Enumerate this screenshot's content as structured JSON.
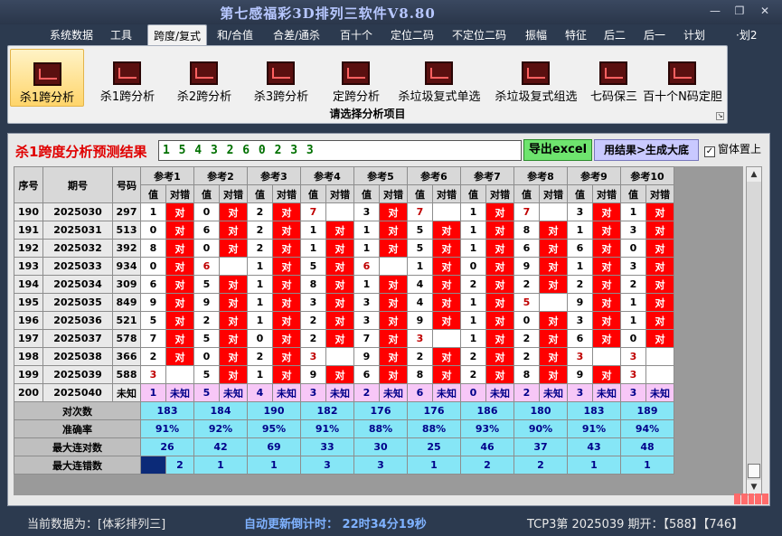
{
  "window": {
    "title": "第七感福彩3D排列三软件V8.80",
    "buttons": {
      "minimize": "—",
      "restore": "❐",
      "close": "✕"
    }
  },
  "menu": [
    "系统数据",
    "工具",
    "跨度/复式",
    "和/合值",
    "合差/通杀",
    "百十个",
    "定位二码",
    "不定位二码",
    "振幅",
    "特征",
    "后二",
    "后一",
    "计划",
    "·划2"
  ],
  "menu_active": 2,
  "ribbon": {
    "buttons": [
      "杀1跨分析",
      "杀1跨分析",
      "杀2跨分析",
      "杀3跨分析",
      "定跨分析",
      "杀垃圾复式单选",
      "杀垃圾复式组选",
      "七码保三",
      "百十个N码定胆"
    ],
    "selected": 0,
    "caption": "请选择分析项目",
    "icon": "chart-icon"
  },
  "result": {
    "title": "杀1跨度分析预测结果",
    "value": "1 5 4 3 2 6 0 2 3 3",
    "export_label": "导出excel",
    "generate_label": "用结果>生成大底",
    "pin_label": "窗体置上",
    "pin_checked": "✓"
  },
  "table": {
    "headers": {
      "seq": "序号",
      "period": "期号",
      "code": "号码"
    },
    "refs": [
      "参考1",
      "参考2",
      "参考3",
      "参考4",
      "参考5",
      "参考6",
      "参考7",
      "参考8",
      "参考9",
      "参考10"
    ],
    "sub": {
      "val": "值",
      "check": "对错"
    },
    "rows": [
      {
        "seq": "190",
        "period": "2025030",
        "code": "297",
        "refs": [
          [
            "1",
            "对"
          ],
          [
            "0",
            "对"
          ],
          [
            "2",
            "对"
          ],
          [
            "7",
            ""
          ],
          [
            "3",
            "对"
          ],
          [
            "7",
            ""
          ],
          [
            "1",
            "对"
          ],
          [
            "7",
            ""
          ],
          [
            "3",
            "对"
          ],
          [
            "1",
            "对"
          ]
        ]
      },
      {
        "seq": "191",
        "period": "2025031",
        "code": "513",
        "refs": [
          [
            "0",
            "对"
          ],
          [
            "6",
            "对"
          ],
          [
            "2",
            "对"
          ],
          [
            "1",
            "对"
          ],
          [
            "1",
            "对"
          ],
          [
            "5",
            "对"
          ],
          [
            "1",
            "对"
          ],
          [
            "8",
            "对"
          ],
          [
            "1",
            "对"
          ],
          [
            "3",
            "对"
          ]
        ]
      },
      {
        "seq": "192",
        "period": "2025032",
        "code": "392",
        "refs": [
          [
            "8",
            "对"
          ],
          [
            "0",
            "对"
          ],
          [
            "2",
            "对"
          ],
          [
            "1",
            "对"
          ],
          [
            "1",
            "对"
          ],
          [
            "5",
            "对"
          ],
          [
            "1",
            "对"
          ],
          [
            "6",
            "对"
          ],
          [
            "6",
            "对"
          ],
          [
            "0",
            "对"
          ]
        ]
      },
      {
        "seq": "193",
        "period": "2025033",
        "code": "934",
        "refs": [
          [
            "0",
            "对"
          ],
          [
            "6",
            ""
          ],
          [
            "1",
            "对"
          ],
          [
            "5",
            "对"
          ],
          [
            "6",
            ""
          ],
          [
            "1",
            "对"
          ],
          [
            "0",
            "对"
          ],
          [
            "9",
            "对"
          ],
          [
            "1",
            "对"
          ],
          [
            "3",
            "对"
          ]
        ]
      },
      {
        "seq": "194",
        "period": "2025034",
        "code": "309",
        "refs": [
          [
            "6",
            "对"
          ],
          [
            "5",
            "对"
          ],
          [
            "1",
            "对"
          ],
          [
            "8",
            "对"
          ],
          [
            "1",
            "对"
          ],
          [
            "4",
            "对"
          ],
          [
            "2",
            "对"
          ],
          [
            "2",
            "对"
          ],
          [
            "2",
            "对"
          ],
          [
            "2",
            "对"
          ]
        ]
      },
      {
        "seq": "195",
        "period": "2025035",
        "code": "849",
        "refs": [
          [
            "9",
            "对"
          ],
          [
            "9",
            "对"
          ],
          [
            "1",
            "对"
          ],
          [
            "3",
            "对"
          ],
          [
            "3",
            "对"
          ],
          [
            "4",
            "对"
          ],
          [
            "1",
            "对"
          ],
          [
            "5",
            ""
          ],
          [
            "9",
            "对"
          ],
          [
            "1",
            "对"
          ]
        ]
      },
      {
        "seq": "196",
        "period": "2025036",
        "code": "521",
        "refs": [
          [
            "5",
            "对"
          ],
          [
            "2",
            "对"
          ],
          [
            "1",
            "对"
          ],
          [
            "2",
            "对"
          ],
          [
            "3",
            "对"
          ],
          [
            "9",
            "对"
          ],
          [
            "1",
            "对"
          ],
          [
            "0",
            "对"
          ],
          [
            "3",
            "对"
          ],
          [
            "1",
            "对"
          ]
        ]
      },
      {
        "seq": "197",
        "period": "2025037",
        "code": "578",
        "refs": [
          [
            "7",
            "对"
          ],
          [
            "5",
            "对"
          ],
          [
            "0",
            "对"
          ],
          [
            "2",
            "对"
          ],
          [
            "7",
            "对"
          ],
          [
            "3",
            ""
          ],
          [
            "1",
            "对"
          ],
          [
            "2",
            "对"
          ],
          [
            "6",
            "对"
          ],
          [
            "0",
            "对"
          ]
        ]
      },
      {
        "seq": "198",
        "period": "2025038",
        "code": "366",
        "refs": [
          [
            "2",
            "对"
          ],
          [
            "0",
            "对"
          ],
          [
            "2",
            "对"
          ],
          [
            "3",
            ""
          ],
          [
            "9",
            "对"
          ],
          [
            "2",
            "对"
          ],
          [
            "2",
            "对"
          ],
          [
            "2",
            "对"
          ],
          [
            "3",
            ""
          ],
          [
            "3",
            ""
          ]
        ]
      },
      {
        "seq": "199",
        "period": "2025039",
        "code": "588",
        "refs": [
          [
            "3",
            ""
          ],
          [
            "5",
            "对"
          ],
          [
            "1",
            "对"
          ],
          [
            "9",
            "对"
          ],
          [
            "6",
            "对"
          ],
          [
            "8",
            "对"
          ],
          [
            "2",
            "对"
          ],
          [
            "8",
            "对"
          ],
          [
            "9",
            "对"
          ],
          [
            "3",
            ""
          ]
        ]
      }
    ],
    "pending": {
      "seq": "200",
      "period": "2025040",
      "code": "未知",
      "refs": [
        [
          "1",
          "未知"
        ],
        [
          "5",
          "未知"
        ],
        [
          "4",
          "未知"
        ],
        [
          "3",
          "未知"
        ],
        [
          "2",
          "未知"
        ],
        [
          "6",
          "未知"
        ],
        [
          "0",
          "未知"
        ],
        [
          "2",
          "未知"
        ],
        [
          "3",
          "未知"
        ],
        [
          "3",
          "未知"
        ]
      ]
    },
    "stats": [
      {
        "label": "对次数",
        "values": [
          "183",
          "184",
          "190",
          "182",
          "176",
          "176",
          "186",
          "180",
          "183",
          "189"
        ]
      },
      {
        "label": "准确率",
        "values": [
          "91%",
          "92%",
          "95%",
          "91%",
          "88%",
          "88%",
          "93%",
          "90%",
          "91%",
          "94%"
        ]
      },
      {
        "label": "最大连对数",
        "values": [
          "26",
          "42",
          "69",
          "33",
          "30",
          "25",
          "46",
          "37",
          "43",
          "48"
        ]
      },
      {
        "label": "最大连错数",
        "values": [
          "2",
          "1",
          "1",
          "3",
          "3",
          "1",
          "2",
          "2",
          "1",
          "1"
        ]
      }
    ]
  },
  "status": {
    "current_data": "当前数据为：[体彩排列三]",
    "countdown": "自动更新倒计时：  22时34分19秒",
    "draw_info": "TCP3第 2025039 期开：【588】【746】"
  },
  "colors": {
    "title_blue": "#b7c7ff",
    "hit_red": "#ff0000",
    "miss_red": "#c00000",
    "pending_pink": "#f7c7f7",
    "stats_cyan": "#86e6f6",
    "result_green": "#007000",
    "excel_green": "#6ee46e",
    "generate_lavender": "#c9c9ff"
  }
}
